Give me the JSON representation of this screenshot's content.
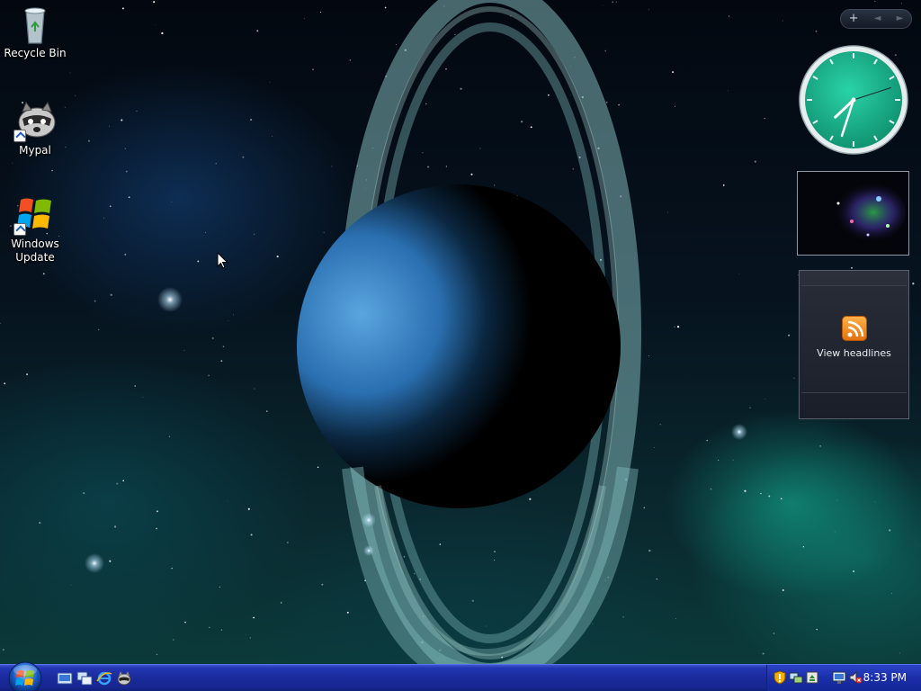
{
  "desktop": {
    "icons": [
      {
        "label": "Recycle Bin",
        "icon": "recycle-bin-icon"
      },
      {
        "label": "Mypal",
        "icon": "mypal-raccoon-icon"
      },
      {
        "label": "Windows Update",
        "icon": "windows-update-icon"
      }
    ]
  },
  "sidebar": {
    "toolbar": {
      "add_label": "+",
      "prev_label": "◄",
      "next_label": "►"
    },
    "clock": {
      "hour": 7,
      "minute": 33,
      "second": 12,
      "face_color": "#1db38e"
    },
    "feed": {
      "label": "View headlines",
      "icon": "rss-feed-icon"
    }
  },
  "taskbar": {
    "start_icon": "windows-orb-icon",
    "quick_launch": [
      "show-desktop-icon",
      "switch-windows-icon",
      "internet-explorer-icon",
      "mypal-icon"
    ],
    "tray_icons": [
      "security-shield-icon",
      "network-icon",
      "safely-remove-icon",
      "network-connection-icon",
      "volume-muted-icon"
    ],
    "time": "8:33 PM",
    "color": "#1a2a9b"
  }
}
